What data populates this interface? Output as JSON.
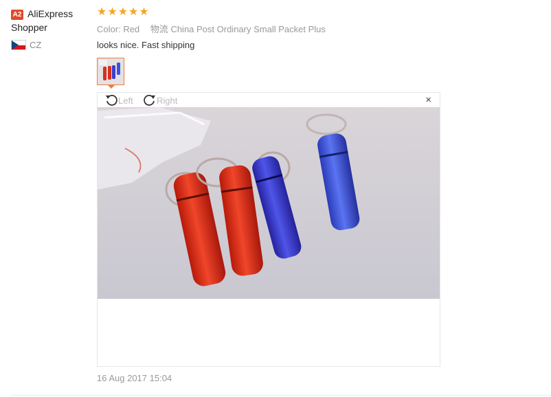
{
  "user": {
    "badge": "A2",
    "name_line1": "AliExpress",
    "name_line2": "Shopper",
    "country": "CZ"
  },
  "review": {
    "stars": "★★★★★",
    "rating": 5,
    "color_label": "Color:",
    "color_value": "Red",
    "shipping_label": "物流",
    "shipping_value": "China Post Ordinary Small Packet Plus",
    "text": "looks nice. Fast shipping",
    "date": "16 Aug 2017 15:04"
  },
  "viewer": {
    "rotate_left_label": "Left",
    "rotate_right_label": "Right",
    "close_symbol": "×"
  },
  "colors": {
    "star": "#f5a623",
    "badge": "#e14a2a",
    "thumb_border": "#f07d3a"
  }
}
